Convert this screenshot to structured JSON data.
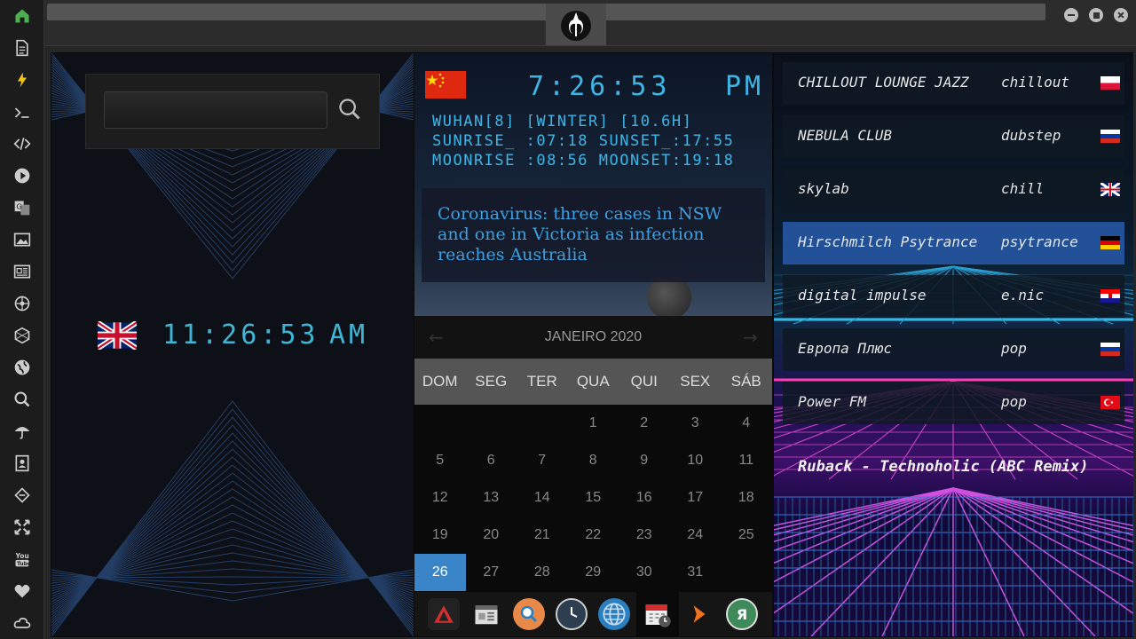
{
  "sidebar": {
    "icons": [
      "home-icon",
      "document-icon",
      "lightning-icon",
      "terminal-icon",
      "code-icon",
      "play-icon",
      "translate-icon",
      "image-icon",
      "news-icon",
      "rebel-icon",
      "hexagon-icon",
      "globe-icon",
      "search-icon",
      "umbrella-icon",
      "contacts-icon",
      "diamond-icon",
      "expand-icon",
      "youtube-icon",
      "heart-icon",
      "cloud-icon"
    ]
  },
  "search": {
    "placeholder": ""
  },
  "left_clock": {
    "time": "11:26:53",
    "ampm": "AM"
  },
  "mid_clock": {
    "time": "7:26:53",
    "ampm": "PM",
    "lines": [
      "WUHAN[8] [WINTER] [10.6H]",
      "SUNRISE_ :07:18 SUNSET_:17:55",
      "MOONRISE :08:56 MOONSET:19:18"
    ]
  },
  "news": {
    "headline": "Coronavirus: three cases in NSW and one in Victoria as infection reaches Australia"
  },
  "calendar": {
    "title": "JANEIRO 2020",
    "day_names": [
      "DOM",
      "SEG",
      "TER",
      "QUA",
      "QUI",
      "SEX",
      "SÁB"
    ],
    "weeks": [
      [
        "",
        "",
        "",
        "1",
        "2",
        "3",
        "4"
      ],
      [
        "5",
        "6",
        "7",
        "8",
        "9",
        "10",
        "11"
      ],
      [
        "12",
        "13",
        "14",
        "15",
        "16",
        "17",
        "18"
      ],
      [
        "19",
        "20",
        "21",
        "22",
        "23",
        "24",
        "25"
      ],
      [
        "26",
        "27",
        "28",
        "29",
        "30",
        "31",
        ""
      ]
    ],
    "today": "26"
  },
  "stations": [
    {
      "name": "CHILLOUT LOUNGE JAZZ",
      "genre": "chillout",
      "flag": "pl"
    },
    {
      "name": "NEBULA CLUB",
      "genre": "dubstep",
      "flag": "ru"
    },
    {
      "name": "skylab",
      "genre": "chill",
      "flag": "gb"
    },
    {
      "name": "Hirschmilch Psytrance",
      "genre": "psytrance",
      "flag": "de"
    },
    {
      "name": "digital impulse",
      "genre": "e.nic",
      "flag": "hr"
    },
    {
      "name": "Европа Плюс",
      "genre": "pop",
      "flag": "ru"
    },
    {
      "name": "Power FM",
      "genre": "pop",
      "flag": "tr"
    }
  ],
  "now_playing": "Ruback - Technoholic (ABC Remix)",
  "dock": [
    "pdf-icon",
    "calendar-news-icon",
    "search-app-icon",
    "clock-icon",
    "globe-app-icon",
    "calendar-app-icon",
    "arrow-app-icon",
    "yandex-icon"
  ],
  "colors": {
    "accent": "#3fb5e5",
    "today": "#3a85c8",
    "active_station": "#2a6ab0"
  }
}
